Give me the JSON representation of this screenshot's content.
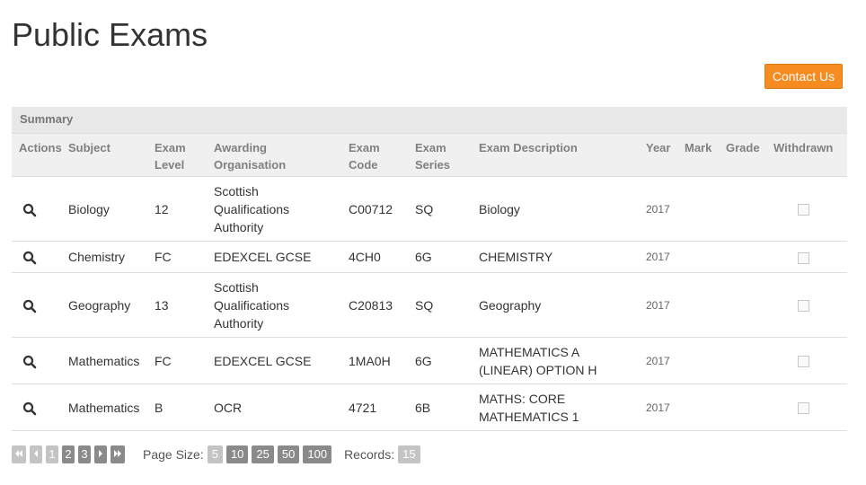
{
  "page": {
    "title": "Public Exams"
  },
  "header": {
    "contact_label": "Contact Us"
  },
  "table": {
    "summary_label": "Summary",
    "columns": [
      [
        "Actions"
      ],
      [
        "Subject"
      ],
      [
        "Exam",
        "Level"
      ],
      [
        "Awarding",
        "Organisation"
      ],
      [
        "Exam",
        "Code"
      ],
      [
        "Exam",
        "Series"
      ],
      [
        "Exam Description"
      ],
      [
        "Year"
      ],
      [
        "Mark"
      ],
      [
        "Grade"
      ],
      [
        "Withdrawn"
      ]
    ],
    "rows": [
      {
        "action_icon": "search-icon",
        "subject": "Biology",
        "level": "12",
        "org": [
          "Scottish",
          "Qualifications",
          "Authority"
        ],
        "code": "C00712",
        "series": "SQ",
        "description": [
          "Biology"
        ],
        "year": "2017",
        "mark": "",
        "grade": "",
        "withdrawn": false
      },
      {
        "action_icon": "search-icon",
        "subject": "Chemistry",
        "level": "FC",
        "org": [
          "EDEXCEL GCSE"
        ],
        "code": "4CH0",
        "series": "6G",
        "description": [
          "CHEMISTRY"
        ],
        "year": "2017",
        "mark": "",
        "grade": "",
        "withdrawn": false
      },
      {
        "action_icon": "search-icon",
        "subject": "Geography",
        "level": "13",
        "org": [
          "Scottish",
          "Qualifications",
          "Authority"
        ],
        "code": "C20813",
        "series": "SQ",
        "description": [
          "Geography"
        ],
        "year": "2017",
        "mark": "",
        "grade": "",
        "withdrawn": false
      },
      {
        "action_icon": "search-icon",
        "subject": "Mathematics",
        "level": "FC",
        "org": [
          "EDEXCEL GCSE"
        ],
        "code": "1MA0H",
        "series": "6G",
        "description": [
          "MATHEMATICS A",
          "(LINEAR) OPTION H"
        ],
        "year": "2017",
        "mark": "",
        "grade": "",
        "withdrawn": false
      },
      {
        "action_icon": "search-icon",
        "subject": "Mathematics",
        "level": "B",
        "org": [
          "OCR"
        ],
        "code": "4721",
        "series": "6B",
        "description": [
          "MATHS: CORE",
          "MATHEMATICS 1"
        ],
        "year": "2017",
        "mark": "",
        "grade": "",
        "withdrawn": false
      }
    ]
  },
  "pager": {
    "pages": [
      "1",
      "2",
      "3"
    ],
    "current_page": "1",
    "page_size_label": "Page Size:",
    "page_sizes": [
      "5",
      "10",
      "25",
      "50",
      "100"
    ],
    "current_page_size": "5",
    "records_label": "Records:",
    "records": "15"
  }
}
